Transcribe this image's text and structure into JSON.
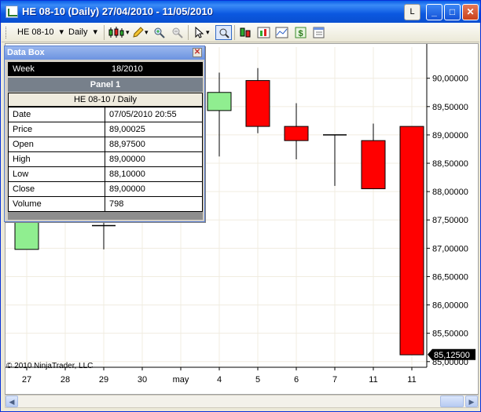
{
  "window": {
    "title": "HE 08-10 (Daily)  27/04/2010 - 11/05/2010",
    "btn_l": "L",
    "btn_min": "_",
    "btn_max": "□",
    "btn_close": "✕"
  },
  "toolbar": {
    "instrument": "HE 08-10",
    "interval": "Daily",
    "dropdown_glyph": "▾",
    "icons": [
      "candlestick-chart-icon",
      "pencil-draw-icon",
      "zoom-in-icon",
      "zoom-out-icon",
      "cursor-pointer-icon",
      "crosshair-icon",
      "bar-type-icon",
      "chart-properties-icon",
      "indicators-icon",
      "strategy-icon",
      "data-box-icon"
    ]
  },
  "databox": {
    "title": "Data Box",
    "header_key": "Week",
    "header_value": "18/2010",
    "panel": "Panel 1",
    "instrument": "HE 08-10 / Daily",
    "rows": [
      {
        "key": "Date",
        "value": "07/05/2010 20:55"
      },
      {
        "key": "Price",
        "value": "89,00025"
      },
      {
        "key": "Open",
        "value": "88,97500"
      },
      {
        "key": "High",
        "value": "89,00000"
      },
      {
        "key": "Low",
        "value": "88,10000"
      },
      {
        "key": "Close",
        "value": "89,00000"
      },
      {
        "key": "Volume",
        "value": "798"
      }
    ]
  },
  "copyright": "© 2010 NinjaTrader, LLC",
  "colors": {
    "up": "#90ee90",
    "down": "#ff0000",
    "wick": "#000000",
    "grid": "#f0ece0"
  },
  "chart_data": {
    "type": "candlestick",
    "ylim": [
      84.9,
      90.55
    ],
    "yticks": [
      "90,00000",
      "89,50000",
      "89,00000",
      "88,50000",
      "88,00000",
      "87,50000",
      "87,00000",
      "86,50000",
      "86,00000",
      "85,50000",
      "85,00000"
    ],
    "ytick_values": [
      90.0,
      89.5,
      89.0,
      88.5,
      88.0,
      87.5,
      87.0,
      86.5,
      86.0,
      85.5,
      85.0
    ],
    "last_price_label": "85,12500",
    "last_price": 85.125,
    "categories": [
      "27",
      "28",
      "29",
      "30",
      "may",
      "4",
      "5",
      "6",
      "7",
      "11",
      "11"
    ],
    "candles": [
      {
        "open": 87.98,
        "high": 88.0,
        "low": 86.98,
        "close": 86.98,
        "dir": "up"
      },
      {
        "open": null,
        "high": null,
        "low": null,
        "close": null,
        "dir": "none"
      },
      {
        "open": 87.38,
        "high": 87.46,
        "low": 86.98,
        "close": 87.4,
        "dir": "doji"
      },
      {
        "open": null,
        "high": null,
        "low": null,
        "close": null,
        "dir": "none"
      },
      {
        "open": null,
        "high": null,
        "low": null,
        "close": null,
        "dir": "none"
      },
      {
        "open": 89.43,
        "high": 90.1,
        "low": 88.62,
        "close": 89.75,
        "dir": "up"
      },
      {
        "open": 89.96,
        "high": 90.18,
        "low": 89.03,
        "close": 89.15,
        "dir": "down"
      },
      {
        "open": 89.15,
        "high": 89.56,
        "low": 88.57,
        "close": 88.9,
        "dir": "down"
      },
      {
        "open": 88.975,
        "high": 89.0,
        "low": 88.1,
        "close": 89.0,
        "dir": "doji"
      },
      {
        "open": 88.9,
        "high": 89.2,
        "low": 88.05,
        "close": 88.05,
        "dir": "down"
      },
      {
        "open": 89.15,
        "high": 89.15,
        "low": 85.12,
        "close": 85.12,
        "dir": "down"
      }
    ]
  }
}
